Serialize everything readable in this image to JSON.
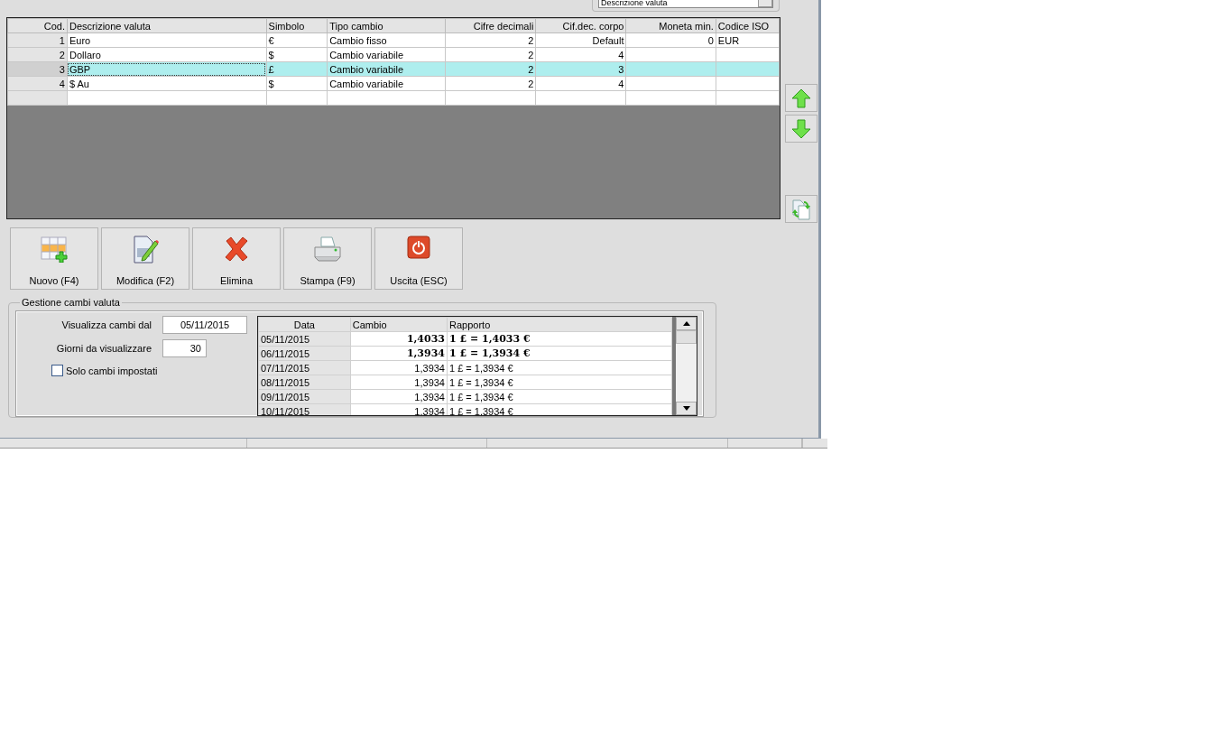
{
  "filter_dropdown": {
    "value": "Descrizione valuta"
  },
  "currency_table": {
    "columns": [
      "Cod.",
      "Descrizione valuta",
      "Simbolo",
      "Tipo cambio",
      "Cifre decimali",
      "Cif.dec. corpo",
      "Moneta min.",
      "Codice ISO"
    ],
    "rows": [
      {
        "selected": false,
        "cells": [
          "1",
          "Euro",
          "€",
          "Cambio fisso",
          "2",
          "Default",
          "0",
          "EUR"
        ]
      },
      {
        "selected": false,
        "cells": [
          "2",
          "Dollaro",
          "$",
          "Cambio variabile",
          "2",
          "4",
          "",
          ""
        ]
      },
      {
        "selected": true,
        "cells": [
          "3",
          "GBP",
          "£",
          "Cambio variabile",
          "2",
          "3",
          "",
          ""
        ]
      },
      {
        "selected": false,
        "cells": [
          "4",
          "$ Au",
          "$",
          "Cambio variabile",
          "2",
          "4",
          "",
          ""
        ]
      }
    ]
  },
  "side_buttons": [
    {
      "kind": "up"
    },
    {
      "kind": "down"
    },
    {
      "kind": "refresh"
    }
  ],
  "toolbar": [
    {
      "kind": "new",
      "label": "Nuovo (F4)"
    },
    {
      "kind": "edit",
      "label": "Modifica (F2)"
    },
    {
      "kind": "delete",
      "label": "Elimina"
    },
    {
      "kind": "print",
      "label": "Stampa (F9)"
    },
    {
      "kind": "exit",
      "label": "Uscita (ESC)"
    }
  ],
  "rates_group": {
    "title": "Gestione cambi valuta",
    "date_label": "Visualizza cambi dal",
    "date_value": "05/11/2015",
    "days_label": "Giorni da visualizzare",
    "days_value": "30",
    "only_set_checkbox": {
      "label": "Solo cambi impostati",
      "checked": false
    },
    "table": {
      "columns": [
        "Data",
        "Cambio",
        "Rapporto"
      ],
      "rows": [
        {
          "bold": true,
          "cells": [
            "05/11/2015",
            "1,4033",
            "1 £ = 1,4033 €"
          ]
        },
        {
          "bold": true,
          "cells": [
            "06/11/2015",
            "1,3934",
            "1 £ = 1,3934 €"
          ]
        },
        {
          "bold": false,
          "cells": [
            "07/11/2015",
            "1,3934",
            "1 £ = 1,3934 €"
          ]
        },
        {
          "bold": false,
          "cells": [
            "08/11/2015",
            "1,3934",
            "1 £ = 1,3934 €"
          ]
        },
        {
          "bold": false,
          "cells": [
            "09/11/2015",
            "1,3934",
            "1 £ = 1,3934 €"
          ]
        },
        {
          "bold": false,
          "cells": [
            "10/11/2015",
            "1,3934",
            "1 £ = 1,3934 €"
          ]
        }
      ]
    }
  }
}
